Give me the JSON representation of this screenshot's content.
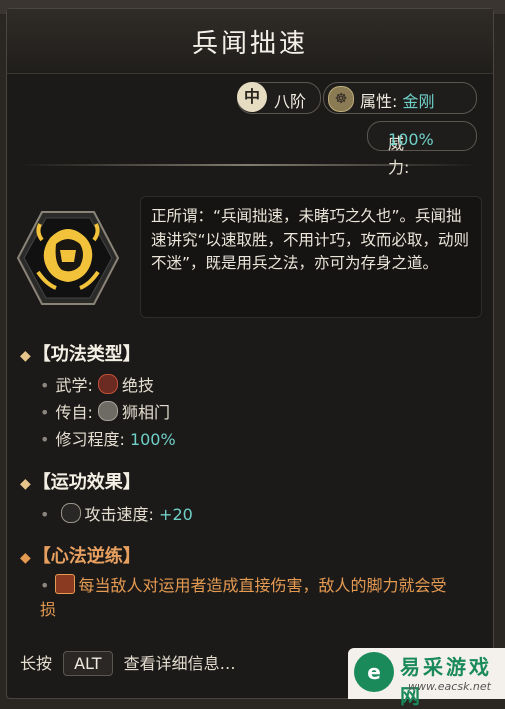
{
  "skill": {
    "title": "兵闻拙速",
    "grade_circle": "中",
    "grade_level": "八阶",
    "attribute_label": "属性:",
    "attribute_value": "金刚",
    "power_label": "威力:",
    "power_value": "100%",
    "icon": "fist-lion-icon"
  },
  "quote": {
    "text": "正所谓：“兵闻拙速，未睹巧之久也”。兵闻拙速讲究“以速取胜，不用计巧，攻而必取，动则不迷”，既是用兵之法，亦可为存身之道。"
  },
  "sections": {
    "type": {
      "header": "【功法类型】",
      "martial_label": "武学:",
      "martial_value": "绝技",
      "origin_label": "传自:",
      "origin_value": "狮相门",
      "practice_label": "修习程度:",
      "practice_value": "100%"
    },
    "effect": {
      "header": "【运功效果】",
      "attack_label": "攻击速度:",
      "attack_value": "+20"
    },
    "reverse": {
      "header": "【心法逆练】",
      "text": "每当敌人对运用者造成直接伤害，敌人的脚力就会受损"
    }
  },
  "hint": {
    "prefix": "长按",
    "key": "ALT",
    "suffix": "查看详细信息…"
  },
  "watermark": {
    "logo": "e",
    "title": "易采游戏网",
    "url": "www.eacsk.net"
  },
  "colors": {
    "accent_teal": "#6fd0c8",
    "accent_orange": "#e59a52",
    "gold": "#e6c58a"
  }
}
